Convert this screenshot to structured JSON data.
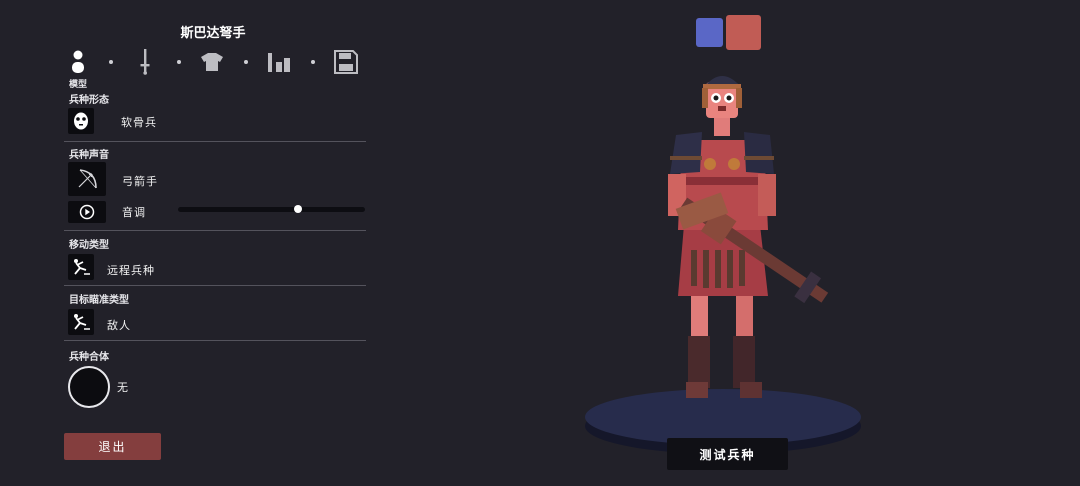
{
  "unit_title": "斯巴达弩手",
  "tabs": [
    {
      "icon": "model-person-icon",
      "caption": "模型"
    },
    {
      "icon": "weapon-sword-icon"
    },
    {
      "icon": "clothing-shirt-icon"
    },
    {
      "icon": "stats-bars-icon"
    },
    {
      "icon": "save-floppy-icon"
    }
  ],
  "sections": {
    "unit_form": {
      "label": "兵种形态",
      "value": "软骨兵",
      "icon": "face-mask-icon"
    },
    "unit_voice": {
      "label": "兵种声音",
      "value": "弓箭手",
      "icon": "bow-icon",
      "pitch_label": "音调",
      "pitch_level": 0.64,
      "play_icon": "play-icon"
    },
    "movement": {
      "label": "移动类型",
      "value": "远程兵种",
      "icon": "movement-icon"
    },
    "targeting": {
      "label": "目标瞄准类型",
      "value": "敌人",
      "icon": "target-icon"
    },
    "combine": {
      "label": "兵种合体",
      "value": "无",
      "icon": "empty-slot-icon"
    }
  },
  "buttons": {
    "exit": "退出",
    "test_unit": "测试兵种"
  },
  "team_colors": [
    "#5a67c6",
    "#c15c55"
  ],
  "colors": {
    "background": "#222129",
    "accent_red": "#843e3e",
    "icon_box": "#0c0c10"
  }
}
